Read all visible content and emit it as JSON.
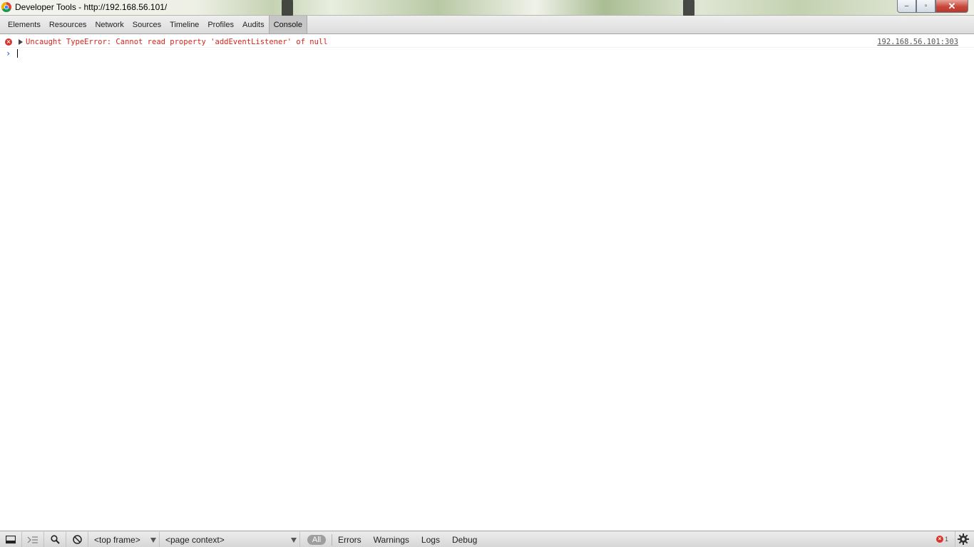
{
  "window": {
    "title": "Developer Tools - http://192.168.56.101/",
    "controls": {
      "minimize": "–",
      "maximize": "▫",
      "close": "✕"
    }
  },
  "tabs": [
    {
      "label": "Elements"
    },
    {
      "label": "Resources"
    },
    {
      "label": "Network"
    },
    {
      "label": "Sources"
    },
    {
      "label": "Timeline"
    },
    {
      "label": "Profiles"
    },
    {
      "label": "Audits"
    },
    {
      "label": "Console",
      "active": true
    }
  ],
  "console": {
    "messages": [
      {
        "level": "error",
        "icon": "error-icon",
        "text": "Uncaught TypeError: Cannot read property 'addEventListener' of null",
        "source": "192.168.56.101:303"
      }
    ],
    "prompt_symbol": "›",
    "input_value": ""
  },
  "statusbar": {
    "dock_icon": "dock-icon",
    "execution_icon": "execution-context-icon",
    "search_icon": "search-icon",
    "clear_icon": "clear-console-icon",
    "frame_select": "<top frame>",
    "context_select": "<page context>",
    "filters": {
      "all": "All",
      "errors": "Errors",
      "warnings": "Warnings",
      "logs": "Logs",
      "debug": "Debug"
    },
    "error_count": "1",
    "settings_icon": "gear-icon"
  },
  "colors": {
    "error_text": "#d5261d",
    "prompt_arrow": "#2d6cd6",
    "error_badge": "#d9342b"
  }
}
